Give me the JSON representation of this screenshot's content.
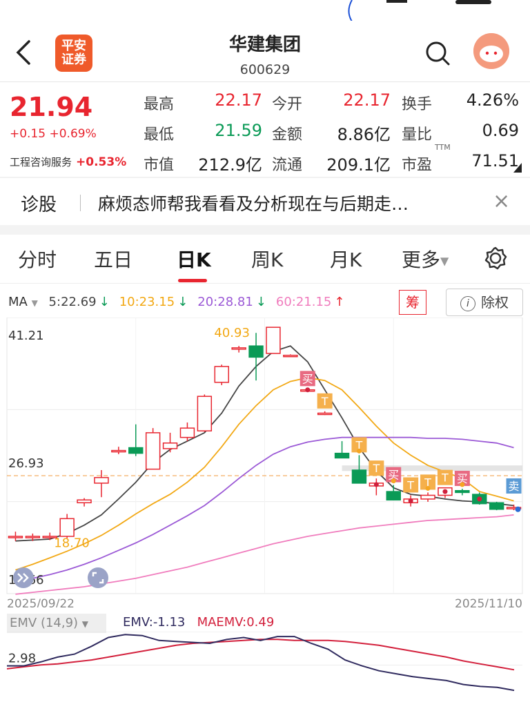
{
  "header": {
    "title": "华建集团",
    "code": "600629",
    "broker_logo": [
      "平安",
      "证券"
    ]
  },
  "quote": {
    "price": "21.94",
    "change": "+0.15 +0.69%",
    "sector_name": "工程咨询服务",
    "sector_change": "+0.53%",
    "fields": [
      {
        "label": "最高",
        "value": "22.17",
        "color": "#e8252f"
      },
      {
        "label": "今开",
        "value": "22.17",
        "color": "#e8252f"
      },
      {
        "label": "换手",
        "value": "4.26%",
        "color": "#222222"
      },
      {
        "label": "最低",
        "value": "21.59",
        "color": "#0a9a56"
      },
      {
        "label": "金额",
        "value": "8.86亿",
        "color": "#222222"
      },
      {
        "label": "量比",
        "value": "0.69",
        "color": "#222222"
      },
      {
        "label": "市值",
        "value": "212.9亿",
        "color": "#222222"
      },
      {
        "label": "流通",
        "value": "209.1亿",
        "color": "#222222"
      },
      {
        "label": "市盈",
        "value": "71.51",
        "color": "#222222"
      }
    ],
    "pe_superscript": "TTM"
  },
  "diagnosis": {
    "label": "诊股",
    "text": "麻烦态师帮我看看及分析现在与后期走…",
    "close": "×"
  },
  "tabs": [
    "分时",
    "五日",
    "日K",
    "周K",
    "月K",
    "更多"
  ],
  "active_tab": "日K",
  "ma_legend": {
    "label": "MA",
    "items": [
      {
        "text": "5:22.69",
        "arrow": "↓",
        "color": "#444444"
      },
      {
        "text": "10:23.15",
        "arrow": "↓",
        "color": "#f2a814"
      },
      {
        "text": "20:28.81",
        "arrow": "↓",
        "color": "#9b59d6"
      },
      {
        "text": "60:21.15",
        "arrow": "↑",
        "color": "#f07cbd"
      }
    ],
    "chip_button": "筹",
    "adjust_button": "除权"
  },
  "chart_data": {
    "type": "candlestick",
    "date_start": "2025/09/22",
    "date_end": "2025/11/10",
    "y_ticks": [
      "41.21",
      "26.93",
      "12.66"
    ],
    "ylim": [
      12.66,
      41.21
    ],
    "max_label": "40.93",
    "min_label": "18.70",
    "reference_line": 25.3,
    "candles": [
      {
        "o": 18.8,
        "h": 19.3,
        "l": 18.3,
        "c": 18.8
      },
      {
        "o": 18.8,
        "h": 19.1,
        "l": 18.3,
        "c": 18.8
      },
      {
        "o": 18.8,
        "h": 19.2,
        "l": 18.4,
        "c": 18.8
      },
      {
        "o": 18.8,
        "h": 21.2,
        "l": 18.6,
        "c": 20.7
      },
      {
        "o": 22.4,
        "h": 22.9,
        "l": 22.0,
        "c": 22.7
      },
      {
        "o": 24.5,
        "h": 25.9,
        "l": 23.0,
        "c": 25.1
      },
      {
        "o": 28.0,
        "h": 28.4,
        "l": 27.6,
        "c": 28.0
      },
      {
        "o": 28.3,
        "h": 30.8,
        "l": 27.4,
        "c": 27.7
      },
      {
        "o": 26.0,
        "h": 30.4,
        "l": 26.0,
        "c": 29.9
      },
      {
        "o": 28.2,
        "h": 29.9,
        "l": 27.8,
        "c": 28.8
      },
      {
        "o": 29.4,
        "h": 31.0,
        "l": 29.0,
        "c": 30.4
      },
      {
        "o": 30.1,
        "h": 34.0,
        "l": 30.0,
        "c": 33.8
      },
      {
        "o": 35.3,
        "h": 37.2,
        "l": 35.0,
        "c": 37.0
      },
      {
        "o": 38.9,
        "h": 39.2,
        "l": 38.5,
        "c": 39.0
      },
      {
        "o": 39.2,
        "h": 40.6,
        "l": 35.5,
        "c": 38.0
      },
      {
        "o": 38.4,
        "h": 41.2,
        "l": 38.4,
        "c": 41.2
      },
      {
        "o": 38.2,
        "h": 38.3,
        "l": 38.1,
        "c": 38.2
      },
      {
        "o": 34.5,
        "h": 34.6,
        "l": 34.4,
        "c": 34.5
      },
      {
        "o": 32.0,
        "h": 32.2,
        "l": 31.8,
        "c": 32.0
      },
      {
        "o": 27.7,
        "h": 29.0,
        "l": 27.3,
        "c": 27.2
      },
      {
        "o": 25.9,
        "h": 27.5,
        "l": 25.5,
        "c": 24.5
      },
      {
        "o": 24.2,
        "h": 25.0,
        "l": 23.2,
        "c": 24.5
      },
      {
        "o": 23.6,
        "h": 24.3,
        "l": 23.0,
        "c": 22.7
      },
      {
        "o": 22.4,
        "h": 23.2,
        "l": 22.0,
        "c": 22.8
      },
      {
        "o": 22.8,
        "h": 23.5,
        "l": 22.5,
        "c": 23.2
      },
      {
        "o": 23.2,
        "h": 24.0,
        "l": 22.9,
        "c": 24.0
      },
      {
        "o": 23.7,
        "h": 23.9,
        "l": 23.2,
        "c": 23.5
      },
      {
        "o": 23.3,
        "h": 23.5,
        "l": 22.2,
        "c": 22.3
      },
      {
        "o": 22.4,
        "h": 22.5,
        "l": 21.6,
        "c": 21.7
      },
      {
        "o": 21.8,
        "h": 22.2,
        "l": 21.6,
        "c": 21.9
      }
    ],
    "ma": [
      {
        "name": "MA5",
        "color": "#444444",
        "values": [
          18.3,
          18.4,
          18.5,
          19.1,
          20.0,
          21.1,
          22.8,
          24.6,
          26.7,
          28.1,
          29.0,
          29.9,
          32.0,
          34.9,
          37.0,
          38.6,
          39.2,
          37.5,
          34.5,
          31.5,
          28.3,
          25.8,
          24.0,
          23.3,
          23.1,
          22.8,
          22.6,
          22.5,
          22.3,
          22.1
        ]
      },
      {
        "name": "MA10",
        "color": "#f2a814",
        "values": [
          15.2,
          15.8,
          16.5,
          17.2,
          18.0,
          18.9,
          20.0,
          21.2,
          22.3,
          23.3,
          24.6,
          26.2,
          28.4,
          30.8,
          32.8,
          34.5,
          35.4,
          35.8,
          35.5,
          34.5,
          32.6,
          30.6,
          28.8,
          27.5,
          26.4,
          25.7,
          25.0,
          23.6,
          23.1,
          22.6
        ]
      },
      {
        "name": "MA20",
        "color": "#9b59d6",
        "values": [
          14.0,
          14.3,
          14.7,
          15.2,
          15.8,
          16.5,
          17.3,
          18.1,
          19.0,
          20.0,
          21.0,
          22.1,
          23.5,
          25.0,
          26.4,
          27.6,
          28.4,
          28.9,
          29.2,
          29.4,
          29.4,
          29.4,
          29.4,
          29.4,
          29.3,
          29.3,
          29.2,
          29.0,
          28.8,
          28.3
        ]
      },
      {
        "name": "MA60",
        "color": "#f07cbd",
        "values": [
          12.6,
          12.8,
          13.0,
          13.2,
          13.4,
          13.7,
          14.0,
          14.3,
          14.7,
          15.1,
          15.5,
          16.0,
          16.5,
          17.0,
          17.5,
          18.0,
          18.4,
          18.8,
          19.1,
          19.4,
          19.7,
          19.9,
          20.1,
          20.3,
          20.5,
          20.6,
          20.7,
          20.8,
          20.9,
          21.1
        ]
      }
    ],
    "signals": [
      {
        "i": 17,
        "text": "买",
        "color": "#e86a82"
      },
      {
        "i": 18,
        "text": "T",
        "color": "#f5b04c"
      },
      {
        "i": 20,
        "text": "T",
        "color": "#f5b04c"
      },
      {
        "i": 21,
        "text": "T",
        "color": "#f5b04c"
      },
      {
        "i": 22,
        "text": "买",
        "color": "#e86a82"
      },
      {
        "i": 23,
        "text": "T",
        "color": "#f5b04c"
      },
      {
        "i": 24,
        "text": "T",
        "color": "#f5b04c"
      },
      {
        "i": 25,
        "text": "T",
        "color": "#f5b04c"
      },
      {
        "i": 26,
        "text": "买",
        "color": "#e86a82"
      },
      {
        "i": 29,
        "text": "卖",
        "color": "#5b9bd5"
      }
    ]
  },
  "emv": {
    "selector": "EMV (14,9)",
    "emv_label": "EMV:-1.13",
    "maemv_label": "MAEMV:0.49",
    "y_tick": "2.98",
    "emv": [
      2.9,
      2.9,
      3.3,
      3.8,
      4.1,
      4.9,
      5.8,
      6.1,
      6.0,
      5.5,
      5.4,
      5.3,
      5.2,
      5.6,
      5.8,
      5.5,
      5.9,
      5.9,
      5.2,
      4.6,
      3.5,
      2.9,
      2.4,
      2.1,
      1.8,
      1.6,
      1.4,
      1.0,
      0.8,
      0.7,
      0.4
    ],
    "maemv": [
      2.6,
      2.8,
      3.0,
      3.1,
      3.3,
      3.5,
      3.8,
      4.1,
      4.4,
      4.7,
      5.0,
      5.2,
      5.3,
      5.4,
      5.5,
      5.6,
      5.6,
      5.5,
      5.5,
      5.5,
      5.4,
      5.2,
      5.0,
      4.7,
      4.4,
      4.1,
      3.8,
      3.4,
      3.1,
      2.8,
      2.5
    ]
  }
}
